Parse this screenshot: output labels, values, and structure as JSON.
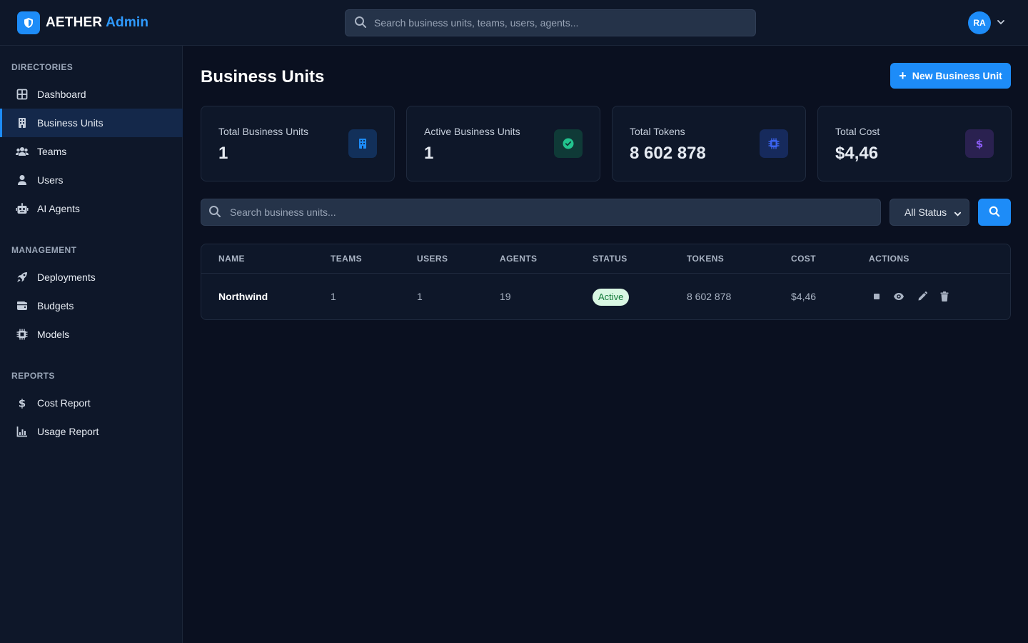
{
  "app": {
    "brand_primary": "AETHER",
    "brand_accent": "Admin"
  },
  "header": {
    "search_placeholder": "Search business units, teams, users, agents...",
    "user_initials": "RA"
  },
  "sidebar": {
    "sections": [
      {
        "heading": "DIRECTORIES",
        "items": [
          {
            "label": "Dashboard",
            "icon": "grid-icon"
          },
          {
            "label": "Business Units",
            "icon": "building-icon",
            "active": true
          },
          {
            "label": "Teams",
            "icon": "users-icon"
          },
          {
            "label": "Users",
            "icon": "user-icon"
          },
          {
            "label": "AI Agents",
            "icon": "robot-icon"
          }
        ]
      },
      {
        "heading": "MANAGEMENT",
        "items": [
          {
            "label": "Deployments",
            "icon": "rocket-icon"
          },
          {
            "label": "Budgets",
            "icon": "wallet-icon"
          },
          {
            "label": "Models",
            "icon": "chip-icon"
          }
        ]
      },
      {
        "heading": "REPORTS",
        "items": [
          {
            "label": "Cost Report",
            "icon": "dollar-icon"
          },
          {
            "label": "Usage Report",
            "icon": "bar-chart-icon"
          }
        ]
      }
    ]
  },
  "main": {
    "title": "Business Units",
    "new_button_label": "New Business Unit",
    "stats": [
      {
        "label": "Total Business Units",
        "value": "1",
        "icon": "building-icon",
        "color": "#1d8cf8"
      },
      {
        "label": "Active Business Units",
        "value": "1",
        "icon": "check-circle-icon",
        "color": "#22c38e"
      },
      {
        "label": "Total Tokens",
        "value": "8 602 878",
        "icon": "chip-icon",
        "color": "#3b63f0"
      },
      {
        "label": "Total Cost",
        "value": "$4,46",
        "icon": "dollar-icon",
        "color": "#8b5cf6"
      }
    ],
    "filter": {
      "search_placeholder": "Search business units...",
      "status_selected": "All Status"
    },
    "table": {
      "columns": [
        "NAME",
        "TEAMS",
        "USERS",
        "AGENTS",
        "STATUS",
        "TOKENS",
        "COST",
        "ACTIONS"
      ],
      "rows": [
        {
          "name": "Northwind",
          "teams": "1",
          "users": "1",
          "agents": "19",
          "status": "Active",
          "tokens": "8 602 878",
          "cost": "$4,46"
        }
      ]
    }
  },
  "colors": {
    "accent": "#1d8cf8",
    "background": "#0a1020",
    "panel": "#0e1729",
    "success": "#22c38e"
  }
}
